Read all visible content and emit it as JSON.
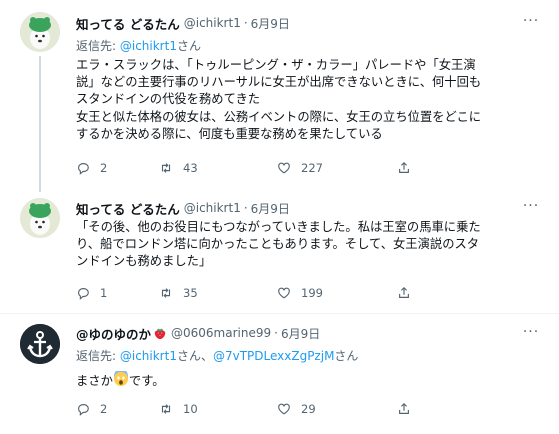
{
  "tweets": [
    {
      "name": "知ってる どるたん",
      "handle": "@ichikrt1",
      "dot": "·",
      "date": "6月9日",
      "reply_prefix": "返信先: ",
      "reply_mention": "@ichikrt1",
      "reply_suffix": "さん",
      "lines": [
        "エラ・スラックは、「トゥルーピング・ザ・カラー」パレードや「女王演",
        "説」などの主要行事のリハーサルに女王が出席できないときに、何十回も",
        "スタンドインの代役を務めてきた",
        "女王と似た体格の彼女は、公務イベントの際に、女王の立ち位置をどこに",
        "するかを決める際に、何度も重要な務めを果たしている"
      ],
      "reply_count": "2",
      "retweet_count": "43",
      "like_count": "227"
    },
    {
      "name": "知ってる どるたん",
      "handle": "@ichikrt1",
      "dot": "·",
      "date": "6月9日",
      "lines": [
        "「その後、他のお役目にもつながっていきました。私は王室の馬車に乗た",
        "り、船でロンドン塔に向かったこともあります。そして、女王演説のスタ",
        "ンドインも務めました」"
      ],
      "reply_count": "1",
      "retweet_count": "35",
      "like_count": "199"
    },
    {
      "name": "@ゆのゆのか",
      "handle": "@0606marine99",
      "dot": "·",
      "date": "6月9日",
      "reply_prefix": "返信先: ",
      "reply_mention": "@ichikrt1",
      "reply_mid": "さん、",
      "reply_mention2": "@7vTPDLexxZgPzjM",
      "reply_suffix": "さん",
      "body_before": "まさか",
      "body_after": "です。",
      "reply_count": "2",
      "retweet_count": "10",
      "like_count": "29"
    }
  ],
  "more_label": "···",
  "colors": {
    "text": "#0f1419",
    "muted": "#536471",
    "link": "#1d9bf0",
    "divider": "#eff3f4"
  }
}
